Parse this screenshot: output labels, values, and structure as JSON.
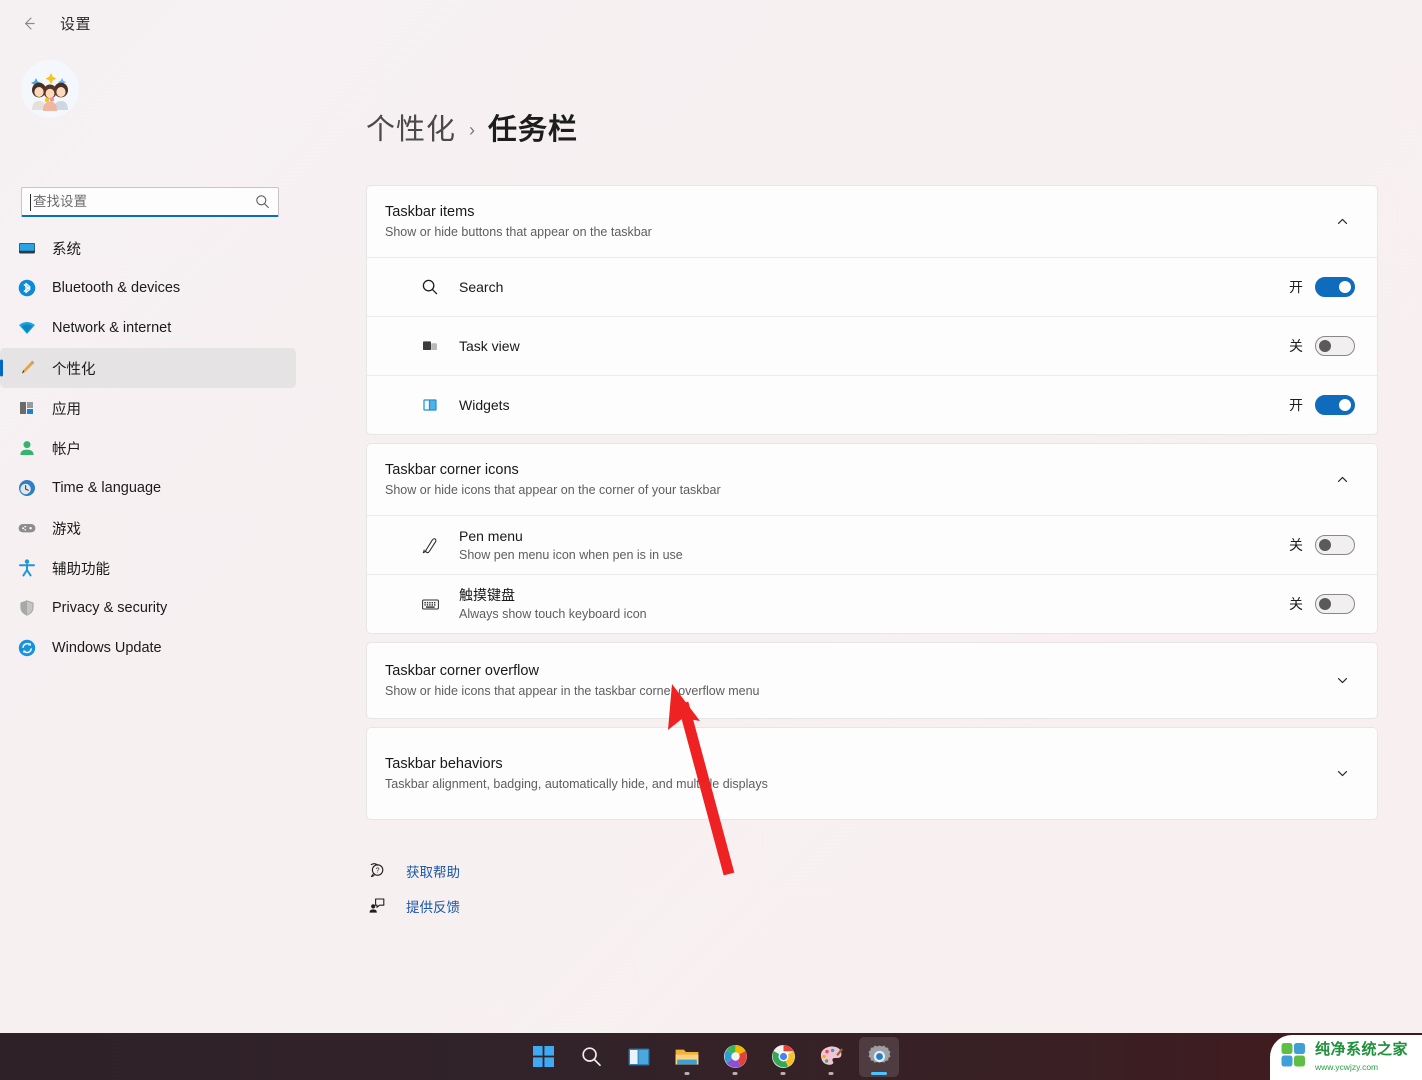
{
  "window": {
    "title": "设置",
    "back_label": "返回"
  },
  "sidebar": {
    "search": {
      "placeholder": "查找设置",
      "value": ""
    },
    "items": [
      {
        "label": "系统",
        "icon": "system-icon",
        "active": false
      },
      {
        "label": "Bluetooth & devices",
        "icon": "bluetooth-icon",
        "active": false
      },
      {
        "label": "Network & internet",
        "icon": "wifi-icon",
        "active": false
      },
      {
        "label": "个性化",
        "icon": "personalization-icon",
        "active": true
      },
      {
        "label": "应用",
        "icon": "apps-icon",
        "active": false
      },
      {
        "label": "帐户",
        "icon": "accounts-icon",
        "active": false
      },
      {
        "label": "Time & language",
        "icon": "time-language-icon",
        "active": false
      },
      {
        "label": "游戏",
        "icon": "gaming-icon",
        "active": false
      },
      {
        "label": "辅助功能",
        "icon": "accessibility-icon",
        "active": false
      },
      {
        "label": "Privacy & security",
        "icon": "shield-icon",
        "active": false
      },
      {
        "label": "Windows Update",
        "icon": "update-icon",
        "active": false
      }
    ]
  },
  "breadcrumb": {
    "parent": "个性化",
    "separator": "›",
    "current": "任务栏"
  },
  "sections": [
    {
      "title": "Taskbar items",
      "subtitle": "Show or hide buttons that appear on the taskbar",
      "expanded": true,
      "chevron": "chevron-up-icon",
      "rows": [
        {
          "icon": "search-icon",
          "title": "Search",
          "subtitle": "",
          "state": "开",
          "on": true
        },
        {
          "icon": "task-view-icon",
          "title": "Task view",
          "subtitle": "",
          "state": "关",
          "on": false
        },
        {
          "icon": "widgets-icon",
          "title": "Widgets",
          "subtitle": "",
          "state": "开",
          "on": true
        }
      ]
    },
    {
      "title": "Taskbar corner icons",
      "subtitle": "Show or hide icons that appear on the corner of your taskbar",
      "expanded": true,
      "chevron": "chevron-up-icon",
      "rows": [
        {
          "icon": "pen-icon",
          "title": "Pen menu",
          "subtitle": "Show pen menu icon when pen is in use",
          "state": "关",
          "on": false
        },
        {
          "icon": "touch-keyboard-icon",
          "title": "触摸键盘",
          "subtitle": "Always show touch keyboard icon",
          "state": "关",
          "on": false
        }
      ]
    },
    {
      "title": "Taskbar corner overflow",
      "subtitle": "Show or hide icons that appear in the taskbar corner overflow menu",
      "expanded": false,
      "chevron": "chevron-down-icon",
      "rows": []
    },
    {
      "title": "Taskbar behaviors",
      "subtitle": "Taskbar alignment, badging, automatically hide, and multiple displays",
      "expanded": false,
      "chevron": "chevron-down-icon",
      "rows": []
    }
  ],
  "footer_links": [
    {
      "icon": "help-icon",
      "label": "获取帮助"
    },
    {
      "icon": "feedback-icon",
      "label": "提供反馈"
    }
  ],
  "annotation": {
    "type": "arrow",
    "color": "#ee2222",
    "points_to": "Taskbar behaviors"
  },
  "taskbar": {
    "items": [
      {
        "name": "start-icon",
        "active": false,
        "indicator": "none"
      },
      {
        "name": "search-icon",
        "active": false,
        "indicator": "none"
      },
      {
        "name": "task-view-icon",
        "active": false,
        "indicator": "none"
      },
      {
        "name": "file-explorer-icon",
        "active": false,
        "indicator": "dot"
      },
      {
        "name": "chrome-beta-icon",
        "active": false,
        "indicator": "dot"
      },
      {
        "name": "chrome-icon",
        "active": false,
        "indicator": "dot"
      },
      {
        "name": "paint-icon",
        "active": false,
        "indicator": "dot"
      },
      {
        "name": "settings-icon",
        "active": true,
        "indicator": "wide"
      }
    ]
  },
  "watermark": {
    "title": "纯净系统之家",
    "url": "www.ycwjzy.com"
  },
  "colors": {
    "accent": "#0f6cbd",
    "link": "#1a56a8",
    "active_nav_bar": "#0067c0",
    "annotation_red": "#ee2222",
    "watermark_green": "#1f8f3a"
  }
}
